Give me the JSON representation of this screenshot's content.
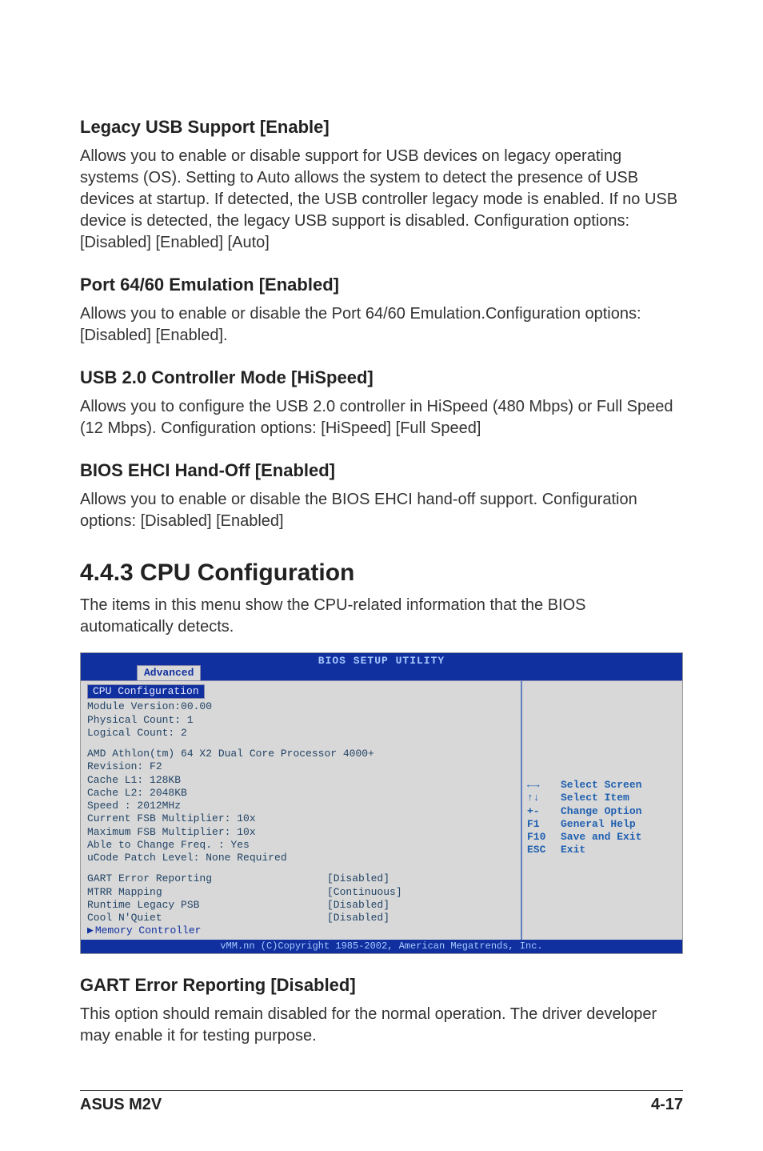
{
  "sections": {
    "legacy_usb": {
      "heading": "Legacy USB Support [Enable]",
      "body": "Allows you to enable or disable support for USB devices on legacy operating systems (OS). Setting to Auto allows the system to detect the presence of USB devices at startup. If detected, the USB controller legacy mode is enabled. If no USB device is detected, the legacy USB support is disabled. Configuration options: [Disabled] [Enabled] [Auto]"
    },
    "port_6460": {
      "heading": "Port 64/60 Emulation [Enabled]",
      "body": "Allows you to enable or disable the Port 64/60 Emulation.Configuration options: [Disabled] [Enabled]."
    },
    "usb20": {
      "heading": "USB 2.0 Controller Mode [HiSpeed]",
      "body": "Allows you to configure the USB 2.0 controller in HiSpeed (480 Mbps) or Full Speed (12 Mbps). Configuration options: [HiSpeed] [Full Speed]"
    },
    "ehci": {
      "heading": "BIOS EHCI Hand-Off [Enabled]",
      "body": "Allows you to enable or disable the BIOS EHCI hand-off support. Configuration options: [Disabled] [Enabled]"
    },
    "cpu_cfg": {
      "heading": "4.4.3   CPU Configuration",
      "body": "The items in this menu show the CPU-related information that the BIOS automatically detects."
    },
    "gart": {
      "heading": "GART Error Reporting [Disabled]",
      "body": "This option should remain disabled for the normal operation. The driver developer may enable it for testing purpose."
    }
  },
  "bios": {
    "title": "BIOS SETUP UTILITY",
    "tab": "Advanced",
    "cfg_title": "CPU Configuration",
    "info_lines": [
      "Module Version:00.00",
      "Physical Count: 1",
      "Logical Count: 2"
    ],
    "cpu_lines": [
      "AMD Athlon(tm) 64 X2 Dual Core Processor 4000+",
      "Revision: F2",
      "Cache L1: 128KB",
      "Cache L2: 2048KB",
      "Speed   : 2012MHz",
      "Current FSB Multiplier: 10x",
      "Maximum FSB Multiplier: 10x",
      "Able to Change Freq. : Yes",
      "uCode Patch Level: None Required"
    ],
    "settings": [
      {
        "label": "GART Error Reporting",
        "value": "[Disabled]"
      },
      {
        "label": "MTRR Mapping",
        "value": "[Continuous]"
      },
      {
        "label": "Runtime Legacy PSB",
        "value": "[Disabled]"
      },
      {
        "label": "Cool N'Quiet",
        "value": "[Disabled]"
      }
    ],
    "memory_controller": "Memory Controller",
    "help_keys": [
      {
        "key": "←→",
        "desc": "Select Screen"
      },
      {
        "key": "↑↓",
        "desc": "Select Item"
      },
      {
        "key": "+-",
        "desc": "Change Option"
      },
      {
        "key": "F1",
        "desc": "General Help"
      },
      {
        "key": "F10",
        "desc": "Save and Exit"
      },
      {
        "key": "ESC",
        "desc": "Exit"
      }
    ],
    "footer": "vMM.nn (C)Copyright 1985-2002, American Megatrends, Inc."
  },
  "footer": {
    "left": "ASUS M2V",
    "right": "4-17"
  }
}
